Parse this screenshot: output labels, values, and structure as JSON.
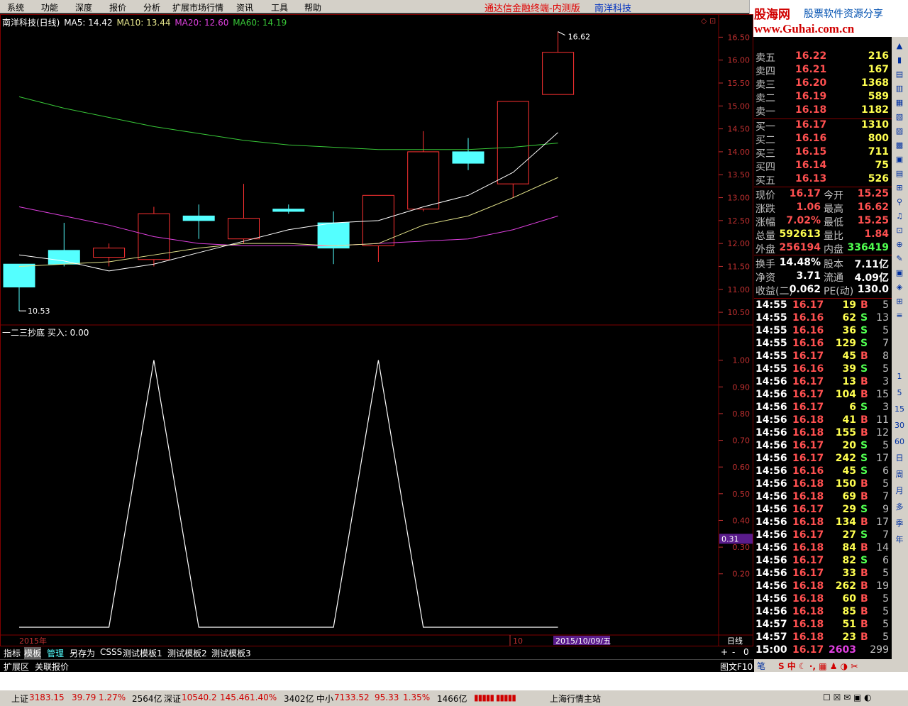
{
  "menu": [
    "系统",
    "功能",
    "深度",
    "报价",
    "分析",
    "扩展市场行情",
    "资讯",
    "工具",
    "帮助"
  ],
  "app_title": "通达信金融终端-内测版",
  "stock_title": "南洋科技",
  "logo": {
    "main": "股海网",
    "sub": "股票软件资源分享",
    "url": "www.Guhai.com.cn"
  },
  "ma_header": {
    "name": "南洋科技(日线)",
    "ma5": "MA5: 14.42",
    "ma10": "MA10: 13.44",
    "ma20": "MA20: 12.60",
    "ma60": "MA60: 14.19"
  },
  "colors": {
    "up": "#ff3232",
    "down": "#54ffff",
    "ma5": "#ffffff",
    "ma10": "#e6e68c",
    "ma20": "#e040e0",
    "ma60": "#38c838",
    "grid": "#800000",
    "axis": "#c03030"
  },
  "indicator_header": "一二三抄底 买入: 0.00",
  "price_axis": [
    "16.50",
    "16.00",
    "15.50",
    "15.00",
    "14.50",
    "14.00",
    "13.50",
    "13.00",
    "12.50",
    "12.00",
    "11.50",
    "11.00",
    "10.50"
  ],
  "ind_axis": [
    "1.00",
    "0.90",
    "0.80",
    "0.70",
    "0.60",
    "0.50",
    "0.40",
    "0.30",
    "0.20"
  ],
  "ind_current": "0.31",
  "high_label": "16.62",
  "low_label": "10.53",
  "x_labels": {
    "year": "2015年",
    "month": "10",
    "date": "2015/10/09/五",
    "period": "日线"
  },
  "chart_data": [
    {
      "type": "candlestick",
      "title": "南洋科技(日线)",
      "candles": [
        {
          "o": 11.55,
          "h": 11.55,
          "l": 10.53,
          "c": 11.05,
          "up": false
        },
        {
          "o": 11.55,
          "h": 12.45,
          "l": 11.5,
          "c": 11.85,
          "up": false
        },
        {
          "o": 11.7,
          "h": 12.0,
          "l": 11.5,
          "c": 11.9,
          "up": true
        },
        {
          "o": 11.65,
          "h": 12.8,
          "l": 11.5,
          "c": 12.65,
          "up": true
        },
        {
          "o": 12.6,
          "h": 12.85,
          "l": 12.1,
          "c": 12.5,
          "up": false
        },
        {
          "o": 12.1,
          "h": 13.3,
          "l": 12.0,
          "c": 12.55,
          "up": true
        },
        {
          "o": 12.75,
          "h": 12.85,
          "l": 12.65,
          "c": 12.7,
          "up": false
        },
        {
          "o": 12.45,
          "h": 12.7,
          "l": 11.55,
          "c": 11.9,
          "up": false
        },
        {
          "o": 11.95,
          "h": 13.05,
          "l": 11.6,
          "c": 13.05,
          "up": true
        },
        {
          "o": 12.75,
          "h": 14.45,
          "l": 12.7,
          "c": 14.0,
          "up": true
        },
        {
          "o": 14.0,
          "h": 14.3,
          "l": 13.6,
          "c": 13.75,
          "up": false
        },
        {
          "o": 13.3,
          "h": 15.1,
          "l": 13.0,
          "c": 15.1,
          "up": true
        },
        {
          "o": 15.25,
          "h": 16.62,
          "l": 15.25,
          "c": 16.17,
          "up": true
        }
      ],
      "ma5": [
        11.75,
        11.62,
        11.4,
        11.55,
        11.8,
        12.05,
        12.3,
        12.45,
        12.5,
        12.8,
        13.05,
        13.55,
        14.42
      ],
      "ma10": [
        11.5,
        11.55,
        11.6,
        11.75,
        11.9,
        12.0,
        12.0,
        11.95,
        12.0,
        12.4,
        12.6,
        13.0,
        13.44
      ],
      "ma20": [
        12.8,
        12.6,
        12.4,
        12.15,
        12.0,
        11.95,
        11.95,
        11.95,
        12.0,
        12.05,
        12.1,
        12.3,
        12.6
      ],
      "ma60": [
        15.2,
        14.95,
        14.75,
        14.55,
        14.4,
        14.25,
        14.15,
        14.1,
        14.05,
        14.05,
        14.05,
        14.1,
        14.19
      ],
      "ylim": [
        10.3,
        16.8
      ]
    },
    {
      "type": "line",
      "title": "一二三抄底",
      "x": [
        0,
        2,
        3,
        4,
        5,
        6,
        7,
        8,
        9,
        10,
        11,
        12
      ],
      "values": [
        0,
        0,
        0,
        1,
        0,
        0,
        0,
        0,
        1,
        0,
        0,
        0
      ],
      "ylim": [
        0,
        1.1
      ]
    }
  ],
  "order_book": {
    "sell": [
      {
        "label": "卖五",
        "price": "16.22",
        "vol": "216"
      },
      {
        "label": "卖四",
        "price": "16.21",
        "vol": "167"
      },
      {
        "label": "卖三",
        "price": "16.20",
        "vol": "1368"
      },
      {
        "label": "卖二",
        "price": "16.19",
        "vol": "589"
      },
      {
        "label": "卖一",
        "price": "16.18",
        "vol": "1182"
      }
    ],
    "buy": [
      {
        "label": "买一",
        "price": "16.17",
        "vol": "1310"
      },
      {
        "label": "买二",
        "price": "16.16",
        "vol": "800"
      },
      {
        "label": "买三",
        "price": "16.15",
        "vol": "711"
      },
      {
        "label": "买四",
        "price": "16.14",
        "vol": "75"
      },
      {
        "label": "买五",
        "price": "16.13",
        "vol": "526"
      }
    ]
  },
  "quote": [
    {
      "l1": "现价",
      "v1": "16.17",
      "c1": "#ff5050",
      "l2": "今开",
      "v2": "15.25",
      "c2": "#ff5050"
    },
    {
      "l1": "涨跌",
      "v1": "1.06",
      "c1": "#ff5050",
      "l2": "最高",
      "v2": "16.62",
      "c2": "#ff5050"
    },
    {
      "l1": "涨幅",
      "v1": "7.02%",
      "c1": "#ff5050",
      "l2": "最低",
      "v2": "15.25",
      "c2": "#ff5050"
    },
    {
      "l1": "总量",
      "v1": "592613",
      "c1": "#ffff50",
      "l2": "量比",
      "v2": "1.84",
      "c2": "#ff5050"
    },
    {
      "l1": "外盘",
      "v1": "256194",
      "c1": "#ff5050",
      "l2": "内盘",
      "v2": "336419",
      "c2": "#50ff50"
    },
    {
      "l1": "换手",
      "v1": "14.48%",
      "c1": "#ffffff",
      "l2": "股本",
      "v2": "7.11亿",
      "c2": "#ffffff"
    },
    {
      "l1": "净资",
      "v1": "3.71",
      "c1": "#ffffff",
      "l2": "流通",
      "v2": "4.09亿",
      "c2": "#ffffff"
    },
    {
      "l1": "收益(二)",
      "v1": "0.062",
      "c1": "#ffffff",
      "l2": "PE(动)",
      "v2": "130.0",
      "c2": "#ffffff"
    }
  ],
  "ticks": [
    [
      "14:55",
      "16.17",
      "19",
      "B",
      "5"
    ],
    [
      "14:55",
      "16.16",
      "62",
      "S",
      "13"
    ],
    [
      "14:55",
      "16.16",
      "36",
      "S",
      "5"
    ],
    [
      "14:55",
      "16.16",
      "129",
      "S",
      "7"
    ],
    [
      "14:55",
      "16.17",
      "45",
      "B",
      "8"
    ],
    [
      "14:55",
      "16.16",
      "39",
      "S",
      "5"
    ],
    [
      "14:56",
      "16.17",
      "13",
      "B",
      "3"
    ],
    [
      "14:56",
      "16.17",
      "104",
      "B",
      "15"
    ],
    [
      "14:56",
      "16.17",
      "6",
      "S",
      "3"
    ],
    [
      "14:56",
      "16.18",
      "41",
      "B",
      "11"
    ],
    [
      "14:56",
      "16.18",
      "155",
      "B",
      "12"
    ],
    [
      "14:56",
      "16.17",
      "20",
      "S",
      "5"
    ],
    [
      "14:56",
      "16.17",
      "242",
      "S",
      "17"
    ],
    [
      "14:56",
      "16.16",
      "45",
      "S",
      "6"
    ],
    [
      "14:56",
      "16.18",
      "150",
      "B",
      "5"
    ],
    [
      "14:56",
      "16.18",
      "69",
      "B",
      "7"
    ],
    [
      "14:56",
      "16.17",
      "29",
      "S",
      "9"
    ],
    [
      "14:56",
      "16.18",
      "134",
      "B",
      "17"
    ],
    [
      "14:56",
      "16.17",
      "27",
      "S",
      "7"
    ],
    [
      "14:56",
      "16.18",
      "84",
      "B",
      "14"
    ],
    [
      "14:56",
      "16.17",
      "82",
      "S",
      "6"
    ],
    [
      "14:56",
      "16.17",
      "33",
      "B",
      "5"
    ],
    [
      "14:56",
      "16.18",
      "262",
      "B",
      "19"
    ],
    [
      "14:56",
      "16.18",
      "60",
      "B",
      "5"
    ],
    [
      "14:56",
      "16.18",
      "85",
      "B",
      "5"
    ],
    [
      "14:57",
      "16.18",
      "51",
      "B",
      "5"
    ],
    [
      "14:57",
      "16.18",
      "23",
      "B",
      "5"
    ],
    [
      "15:00",
      "16.17",
      "2603",
      "",
      "299"
    ]
  ],
  "tabs": [
    "指标",
    "模板",
    "管理",
    "另存为",
    "CSSS",
    "测试模板1",
    "测试模板2",
    "测试模板3"
  ],
  "tab_controls": [
    "+",
    "-",
    "0"
  ],
  "tabs2": [
    "扩展区",
    "关联报价"
  ],
  "tabs2_right": "图文F10",
  "bottom_right_tab": "笔",
  "tools": [
    "1",
    "5",
    "15",
    "30",
    "60",
    "日",
    "周",
    "月",
    "多",
    "季",
    "年"
  ],
  "status": {
    "sh_label": "上证",
    "sh_val": "3183.15",
    "sh_chg": "39.79",
    "sh_pct": "1.27%",
    "sh_amt": "2564亿",
    "sz_label": "深证",
    "sz_val": "10540.2",
    "sz_chg": "145.46",
    "sz_pct": "1.40%",
    "sz_amt": "3402亿",
    "zx_label": "中小",
    "zx_val": "7133.52",
    "zx_chg": "95.33",
    "zx_pct": "1.35%",
    "zx_amt": "1466亿",
    "station": "上海行情主站"
  }
}
